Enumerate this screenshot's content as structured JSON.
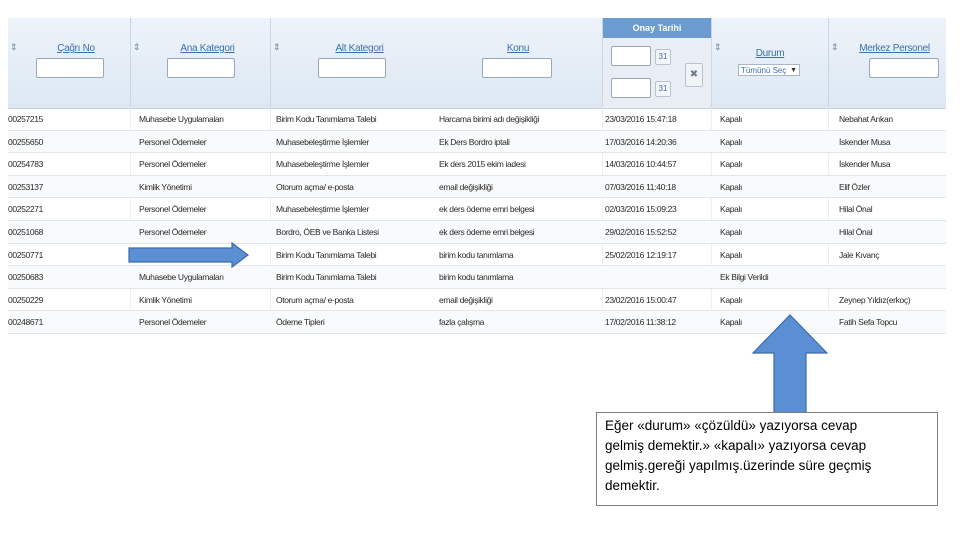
{
  "columns": {
    "cagri_no": "Çağrı No",
    "ana_kategori": "Ana Kategori",
    "alt_kategori": "Alt Kategori",
    "konu": "Konu",
    "onay_tarihi": "Onay Tarihi",
    "durum": "Durum",
    "merkez_personel": "Merkez Personel"
  },
  "filters": {
    "durum_selected": "Tümünü Seç",
    "clear_symbol": "✖",
    "calendar_symbol": "31"
  },
  "sort_icon": "⇕",
  "rows": [
    {
      "no": "00257215",
      "ana": "Muhasebe Uygulamaları",
      "alt": "Birim Kodu Tanımlama Talebi",
      "konu": "Harcama birimi adı değişikliği",
      "tarih": "23/03/2016 15:47:18",
      "durum": "Kapalı",
      "personel": "Nebahat Arıkan"
    },
    {
      "no": "00255650",
      "ana": "Personel Ödemeler",
      "alt": "Muhasebeleştirme İşlemler",
      "konu": "Ek Ders Bordro iptali",
      "tarih": "17/03/2016 14:20:36",
      "durum": "Kapalı",
      "personel": "İskender Musa"
    },
    {
      "no": "00254783",
      "ana": "Personel Ödemeler",
      "alt": "Muhasebeleştirme İşlemler",
      "konu": "Ek ders 2015 ekim iadesi",
      "tarih": "14/03/2016 10:44:57",
      "durum": "Kapalı",
      "personel": "İskender Musa"
    },
    {
      "no": "00253137",
      "ana": "Kimlik Yönetimi",
      "alt": "Otorum açma/ e-posta",
      "konu": "email değişikliği",
      "tarih": "07/03/2016 11:40:18",
      "durum": "Kapalı",
      "personel": "Elif Özler"
    },
    {
      "no": "00252271",
      "ana": "Personel Ödemeler",
      "alt": "Muhasebeleştirme İşlemler",
      "konu": "ek ders ödeme emri belgesi",
      "tarih": "02/03/2016 15:09:23",
      "durum": "Kapalı",
      "personel": "Hilal Önal"
    },
    {
      "no": "00251068",
      "ana": "Personel Ödemeler",
      "alt": "Bordro, ÖEB ve Banka Listesi",
      "konu": "ek ders ödeme emri belgesi",
      "tarih": "29/02/2016 15:52:52",
      "durum": "Kapalı",
      "personel": "Hilal Önal"
    },
    {
      "no": "00250771",
      "ana": "",
      "alt": "Birim Kodu Tanımlama Talebi",
      "konu": "birim kodu tanımlama",
      "tarih": "25/02/2016 12:19:17",
      "durum": "Kapalı",
      "personel": "Jale Kıvanç"
    },
    {
      "no": "00250683",
      "ana": "Muhasebe Uygulamaları",
      "alt": "Birim Kodu Tanımlama Talebi",
      "konu": "birim kodu tanımlama",
      "tarih": "",
      "durum": "Ek Bilgi Verildi",
      "personel": ""
    },
    {
      "no": "00250229",
      "ana": "Kimlik Yönetimi",
      "alt": "Otorum açma/ e-posta",
      "konu": "email değişikliği",
      "tarih": "23/02/2016 15:00:47",
      "durum": "Kapalı",
      "personel": "Zeynep Yıldız(erkoç)"
    },
    {
      "no": "00248671",
      "ana": "Personel Ödemeler",
      "alt": "Ödeme Tipleri",
      "konu": "fazla çalışma",
      "tarih": "17/02/2016 11:38:12",
      "durum": "Kapalı",
      "personel": "Fatih Sefa Topcu"
    }
  ],
  "note": {
    "line1": "Eğer «durum» «çözüldü» yazıyorsa cevap",
    "line2": "gelmiş demektir.»   «kapalı» yazıyorsa cevap",
    "line3": "gelmiş.gereği yapılmış.üzerinde süre geçmiş",
    "line4": "demektir."
  }
}
